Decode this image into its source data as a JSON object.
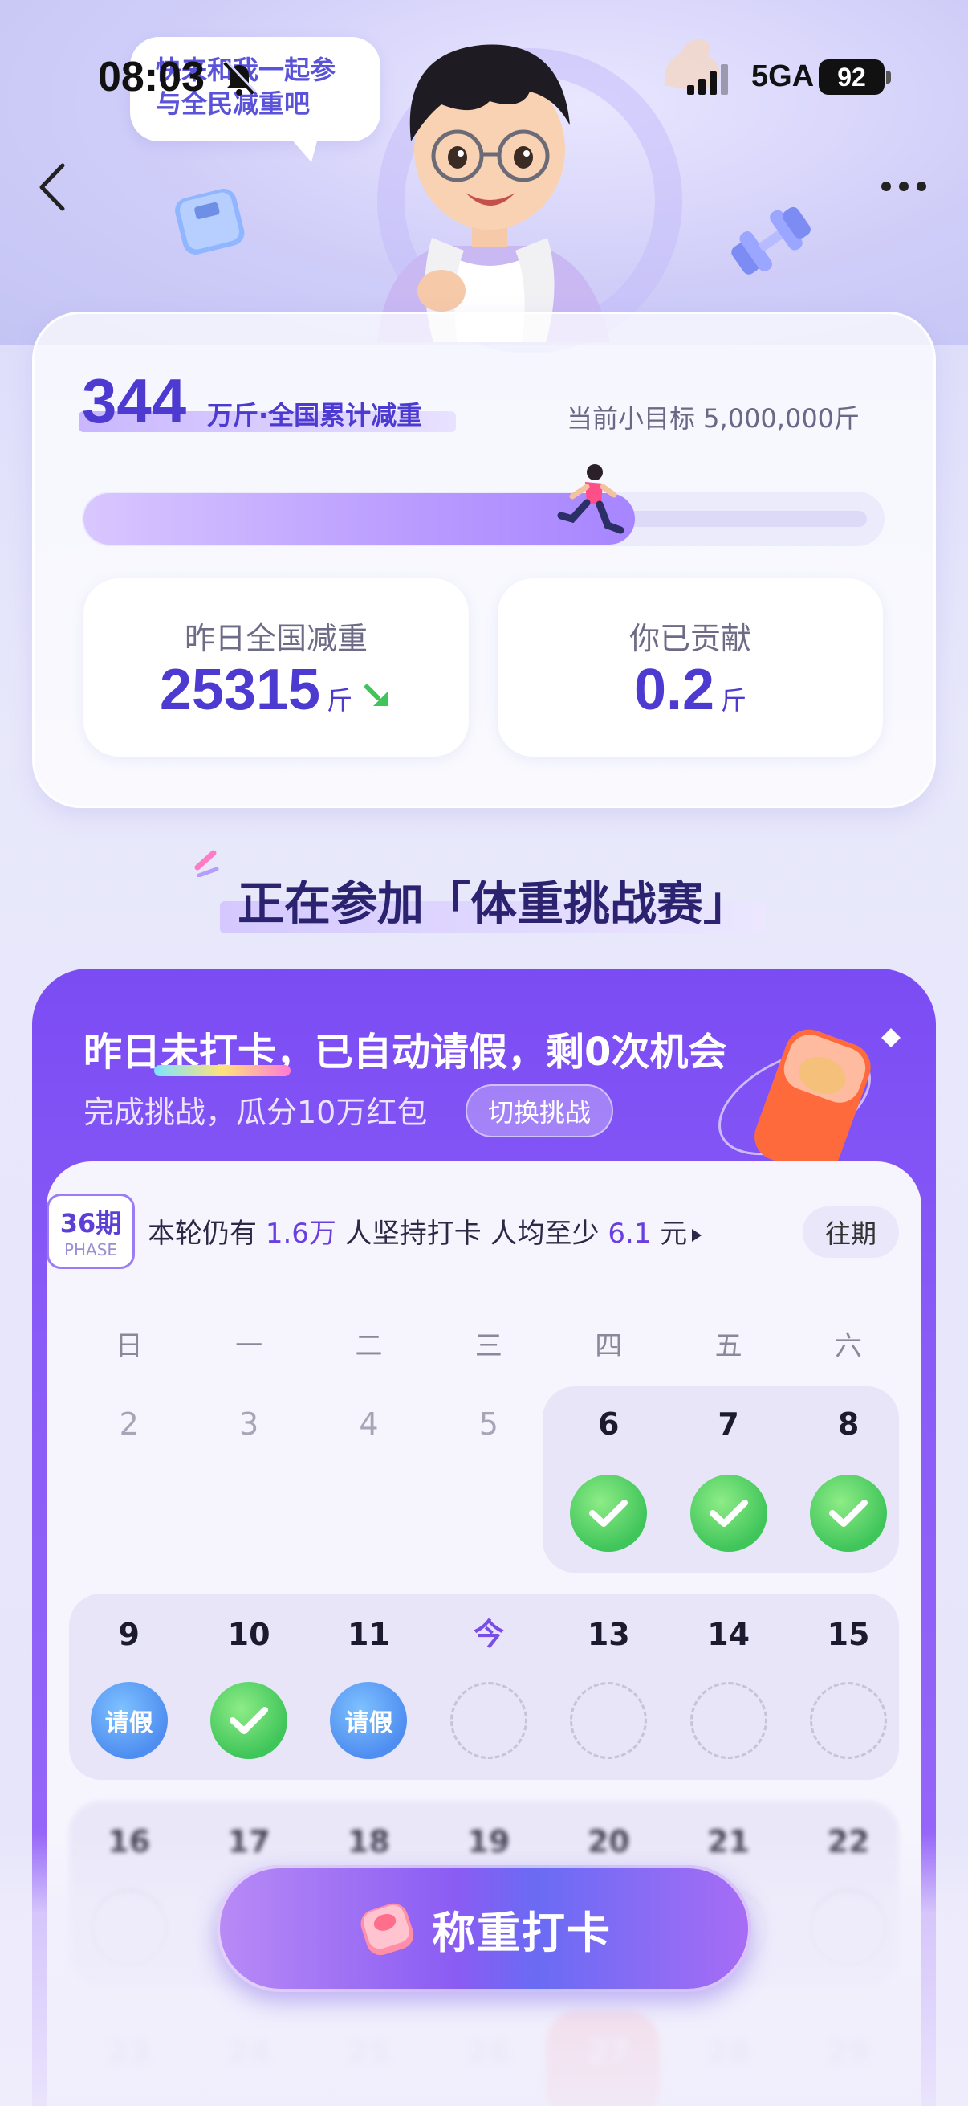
{
  "status_bar": {
    "time": "08:03",
    "network": "5GA",
    "battery": "92"
  },
  "hero": {
    "bubble_text": [
      "快来和我一起参",
      "与全民减重吧"
    ]
  },
  "stats": {
    "total_value": "344",
    "total_unit": "万斤·全国累计减重",
    "goal_text": "当前小目标 5,000,000斤",
    "progress_fraction": 0.69,
    "yesterday_label": "昨日全国减重",
    "yesterday_value": "25315",
    "yesterday_unit": "斤",
    "contrib_label": "你已贡献",
    "contrib_value": "0.2",
    "contrib_unit": "斤"
  },
  "section_title": "正在参加「体重挑战赛」",
  "challenge": {
    "title": "昨日未打卡，已自动请假，剩0次机会",
    "subtitle": "完成挑战，瓜分10万红包",
    "switch_label": "切换挑战",
    "phase_num": "36期",
    "phase_en": "PHASE",
    "round_prefix": "本轮仍有",
    "round_people": "1.6万",
    "round_mid": "人坚持打卡 人均至少",
    "round_amount": "6.1",
    "round_suffix": "元",
    "past_label": "往期",
    "weekdays": [
      "日",
      "一",
      "二",
      "三",
      "四",
      "五",
      "六"
    ],
    "week1": [
      "2",
      "3",
      "4",
      "5",
      "6",
      "7",
      "8"
    ],
    "week2": [
      "9",
      "10",
      "11",
      "今",
      "13",
      "14",
      "15"
    ],
    "week2_marks": [
      "请假",
      "",
      "请假",
      "",
      "",
      "",
      ""
    ],
    "week3": [
      "16",
      "17",
      "18",
      "19",
      "20",
      "21",
      "22"
    ],
    "week4": [
      "23",
      "24",
      "25",
      "26",
      "27",
      "28",
      "29"
    ]
  },
  "action_button": {
    "label": "称重打卡"
  },
  "colors": {
    "accent": "#7b4cf3",
    "check_green": "#3fc55a",
    "leave_blue": "#4f8ef0"
  }
}
